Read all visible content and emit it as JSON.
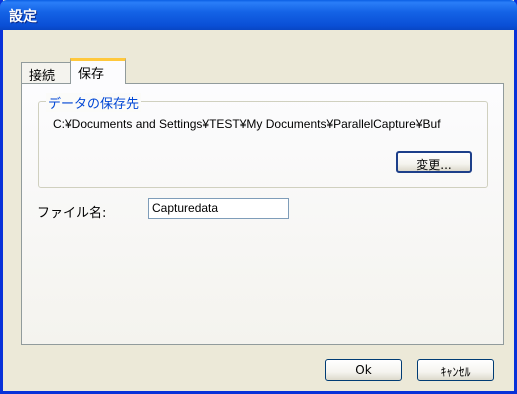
{
  "window": {
    "title": "設定"
  },
  "tabs": [
    {
      "label": "接続",
      "active": false
    },
    {
      "label": "保存",
      "active": true
    }
  ],
  "save_panel": {
    "group_title": "データの保存先",
    "path": "C:¥Documents and Settings¥TEST¥My Documents¥ParallelCapture¥Buf",
    "change_button": "変更...",
    "filename_label": "ファイル名:",
    "filename_value": "Capturedata"
  },
  "footer": {
    "ok_label": "Ok",
    "cancel_label": "ｷｬﾝｾﾙ"
  },
  "colors": {
    "titlebar": "#0a4fd6",
    "window_bg": "#ece9d8",
    "group_title": "#0046d5",
    "active_tab_accent": "#ffc83c"
  }
}
